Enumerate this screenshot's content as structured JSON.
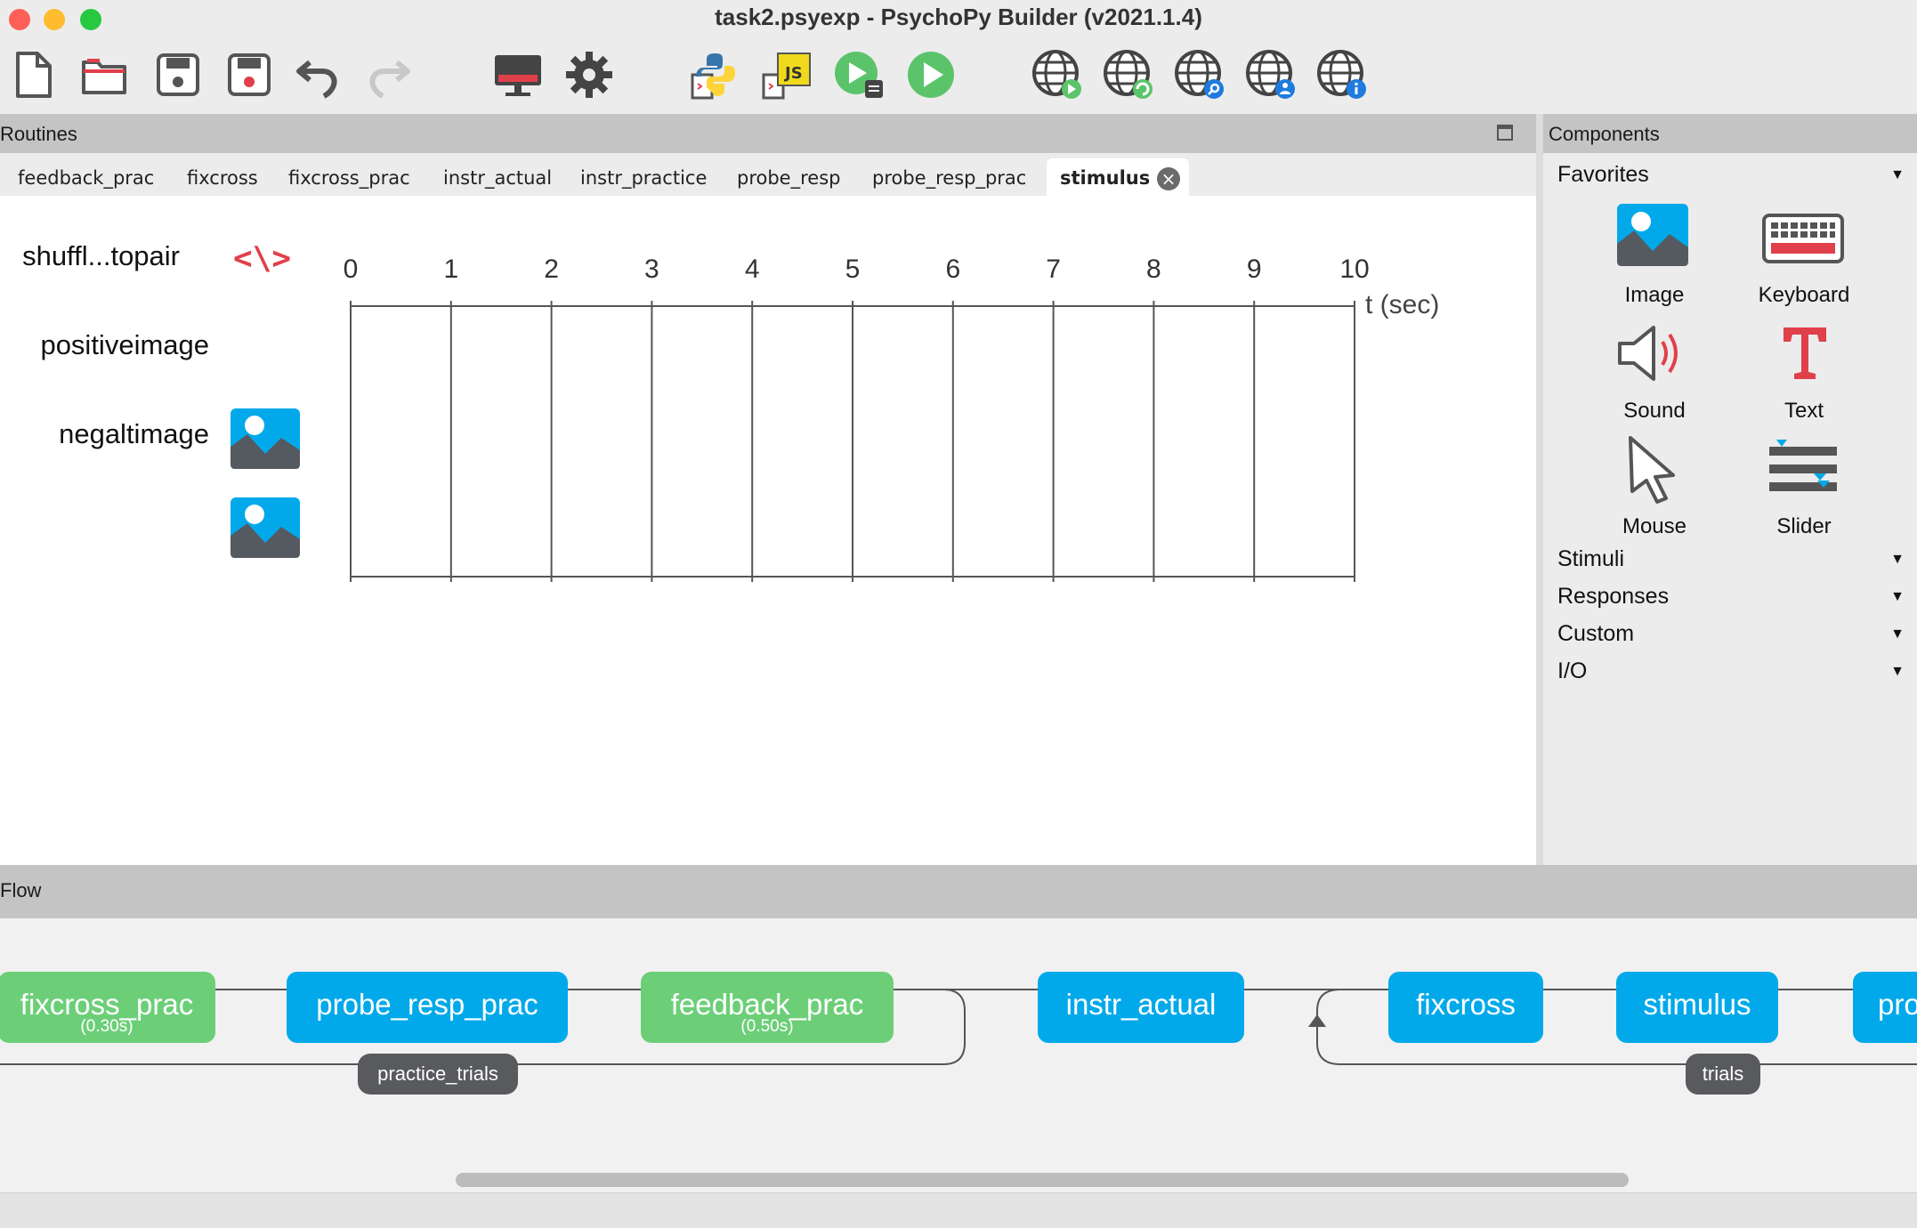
{
  "window": {
    "title": "task2.psyexp - PsychoPy Builder (v2021.1.4)",
    "traffic_lights": {
      "close": "#fe5f57",
      "minimize": "#febc2e",
      "zoom": "#28c840"
    }
  },
  "toolbar": {
    "buttons": [
      {
        "name": "new-file-icon"
      },
      {
        "name": "open-folder-icon"
      },
      {
        "name": "save-icon"
      },
      {
        "name": "save-as-icon"
      },
      {
        "name": "undo-icon"
      },
      {
        "name": "redo-icon"
      },
      {
        "name": "monitor-icon"
      },
      {
        "name": "settings-gear-icon"
      },
      {
        "name": "compile-python-icon"
      },
      {
        "name": "compile-js-icon"
      },
      {
        "name": "run-in-runner-icon"
      },
      {
        "name": "run-icon"
      },
      {
        "name": "pavlovia-run-online-icon"
      },
      {
        "name": "pavlovia-sync-icon"
      },
      {
        "name": "pavlovia-search-icon"
      },
      {
        "name": "pavlovia-user-icon"
      },
      {
        "name": "pavlovia-project-info-icon"
      }
    ]
  },
  "routines": {
    "header": "Routines",
    "tabs": [
      {
        "label": "feedback_prac"
      },
      {
        "label": "fixcross"
      },
      {
        "label": "fixcross_prac"
      },
      {
        "label": "instr_actual"
      },
      {
        "label": "instr_practice"
      },
      {
        "label": "probe_resp"
      },
      {
        "label": "probe_resp_prac"
      },
      {
        "label": "stimulus"
      }
    ],
    "active_tab": "stimulus",
    "timeline": {
      "ticks": [
        "0",
        "1",
        "2",
        "3",
        "4",
        "5",
        "6",
        "7",
        "8",
        "9",
        "10"
      ],
      "unit_label": "t (sec)",
      "components": [
        {
          "label": "shuffl...topair",
          "icon": "code-icon"
        },
        {
          "label": "positiveimage",
          "icon": "image-icon"
        },
        {
          "label": "negaltimage",
          "icon": "image-icon"
        }
      ]
    }
  },
  "components_panel": {
    "header": "Components",
    "favorites_label": "Favorites",
    "favorites": [
      {
        "label": "Image",
        "icon": "image-icon"
      },
      {
        "label": "Keyboard",
        "icon": "keyboard-icon"
      },
      {
        "label": "Sound",
        "icon": "speaker-icon"
      },
      {
        "label": "Text",
        "icon": "text-icon"
      },
      {
        "label": "Mouse",
        "icon": "mouse-pointer-icon"
      },
      {
        "label": "Slider",
        "icon": "slider-icon"
      }
    ],
    "categories": [
      {
        "label": "Stimuli"
      },
      {
        "label": "Responses"
      },
      {
        "label": "Custom"
      },
      {
        "label": "I/O"
      }
    ]
  },
  "flow": {
    "header": "Flow",
    "routines": [
      {
        "label": "fixcross_prac",
        "duration": "(0.30s)",
        "color": "#6ccf78"
      },
      {
        "label": "probe_resp_prac",
        "duration": "",
        "color": "#02a9ea"
      },
      {
        "label": "feedback_prac",
        "duration": "(0.50s)",
        "color": "#6ccf78"
      },
      {
        "label": "instr_actual",
        "duration": "",
        "color": "#02a9ea"
      },
      {
        "label": "fixcross",
        "duration": "",
        "color": "#02a9ea"
      },
      {
        "label": "stimulus",
        "duration": "",
        "color": "#02a9ea"
      },
      {
        "label": "pro",
        "duration": "",
        "color": "#02a9ea"
      }
    ],
    "loops": [
      {
        "label": "practice_trials"
      },
      {
        "label": "trials"
      }
    ]
  }
}
